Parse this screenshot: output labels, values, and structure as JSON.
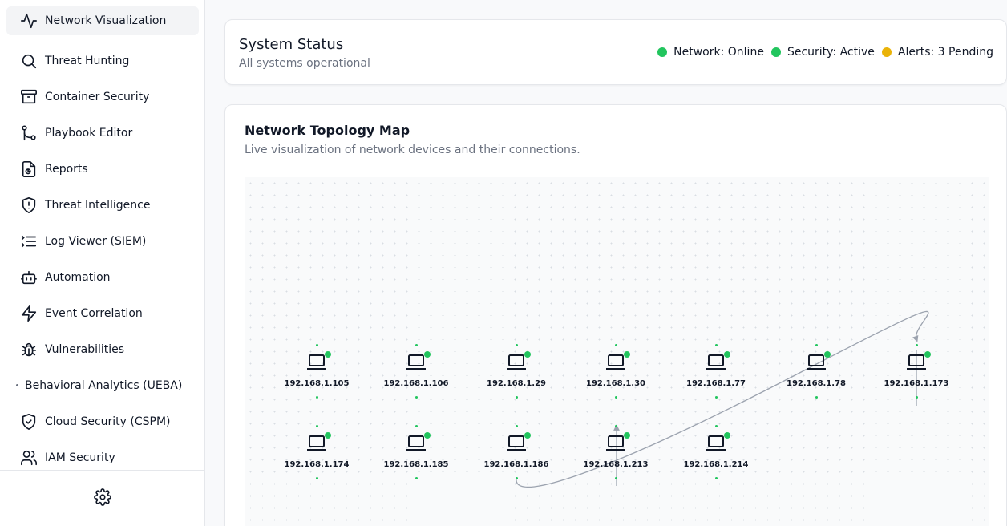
{
  "sidebar": {
    "items": [
      {
        "label": "Network Visualization",
        "icon": "activity-icon"
      },
      {
        "label": "Threat Hunting",
        "icon": "search-icon"
      },
      {
        "label": "Container Security",
        "icon": "archive-icon"
      },
      {
        "label": "Playbook Editor",
        "icon": "git-branch-icon"
      },
      {
        "label": "Reports",
        "icon": "file-chart-icon"
      },
      {
        "label": "Threat Intelligence",
        "icon": "shield-alert-icon"
      },
      {
        "label": "Log Viewer (SIEM)",
        "icon": "list-icon"
      },
      {
        "label": "Automation",
        "icon": "bot-icon"
      },
      {
        "label": "Event Correlation",
        "icon": "zap-icon"
      },
      {
        "label": "Vulnerabilities",
        "icon": "bug-icon"
      },
      {
        "label": "Behavioral Analytics (UEBA)",
        "icon": "dot-icon"
      },
      {
        "label": "Cloud Security (CSPM)",
        "icon": "shield-check-icon"
      },
      {
        "label": "IAM Security",
        "icon": "users-icon"
      }
    ],
    "footer_icon": "settings-icon"
  },
  "status": {
    "title": "System Status",
    "subtitle": "All systems operational",
    "indicators": [
      {
        "label": "Network: Online",
        "color": "#22c55e"
      },
      {
        "label": "Security: Active",
        "color": "#22c55e"
      },
      {
        "label": "Alerts: 3 Pending",
        "color": "#eab308"
      }
    ]
  },
  "topology": {
    "title": "Network Topology Map",
    "subtitle": "Live visualization of network devices and their connections.",
    "nodes": [
      {
        "ip": "192.168.1.105"
      },
      {
        "ip": "192.168.1.106"
      },
      {
        "ip": "192.168.1.29"
      },
      {
        "ip": "192.168.1.30"
      },
      {
        "ip": "192.168.1.77"
      },
      {
        "ip": "192.168.1.78"
      },
      {
        "ip": "192.168.1.173"
      },
      {
        "ip": "192.168.1.174"
      },
      {
        "ip": "192.168.1.185"
      },
      {
        "ip": "192.168.1.186"
      },
      {
        "ip": "192.168.1.213"
      },
      {
        "ip": "192.168.1.214"
      }
    ],
    "links": [
      {
        "from": "192.168.1.186",
        "to": "192.168.1.173"
      }
    ]
  }
}
